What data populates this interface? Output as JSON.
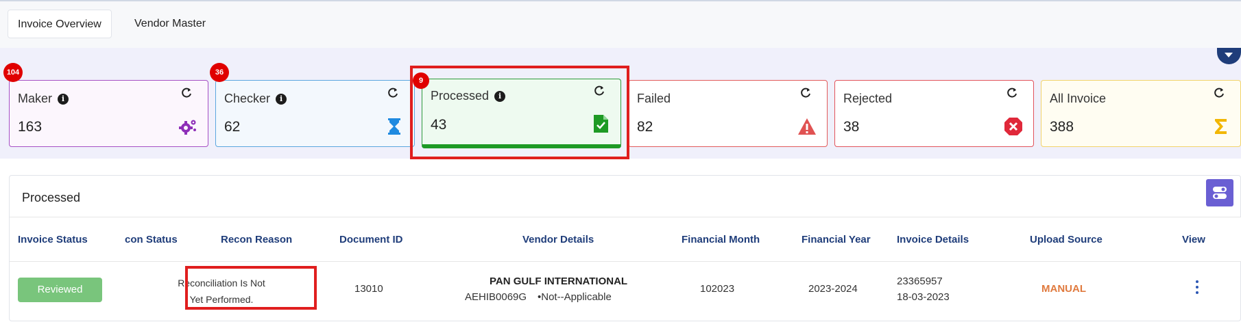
{
  "tabs": [
    {
      "label": "Invoice Overview",
      "active": true
    },
    {
      "label": "Vendor Master",
      "active": false
    }
  ],
  "cards": {
    "maker": {
      "label": "Maker",
      "count": "163",
      "badge": "104",
      "icon": "gears-icon",
      "color": "#8e2fb8"
    },
    "checker": {
      "label": "Checker",
      "count": "62",
      "badge": "36",
      "icon": "hourglass-icon",
      "color": "#1f8ae0"
    },
    "processed": {
      "label": "Processed",
      "count": "43",
      "badge": "9",
      "icon": "file-check-icon",
      "color": "#1e9a25"
    },
    "failed": {
      "label": "Failed",
      "count": "82",
      "icon": "warning-icon",
      "color": "#e05252"
    },
    "rejected": {
      "label": "Rejected",
      "count": "38",
      "icon": "x-circle-icon",
      "color": "#e0283a"
    },
    "all": {
      "label": "All Invoice",
      "count": "388",
      "icon": "sigma-icon",
      "color": "#f2b705"
    }
  },
  "panel": {
    "title": "Processed",
    "columns": [
      "Invoice Status",
      "con Status",
      "Recon Reason",
      "Document ID",
      "Vendor Details",
      "Financial Month",
      "Financial Year",
      "Invoice Details",
      "Upload Source",
      "View"
    ],
    "row": {
      "invoice_status": "Reviewed",
      "recon_reason_line1": "Reconciliation Is Not",
      "recon_reason_line2": "Yet Performed.",
      "document_id": "13010",
      "vendor_name": "PAN GULF INTERNATIONAL",
      "vendor_code": "AEHIB0069G",
      "vendor_extra": "•Not--Applicable",
      "financial_month": "102023",
      "financial_year": "2023-2024",
      "invoice_number": "23365957",
      "invoice_date": "18-03-2023",
      "upload_source": "MANUAL"
    }
  },
  "colors": {
    "accent": "#1f3d7a",
    "upload_source": "#e07a3e",
    "highlight": "#e01e1e",
    "reviewed": "#79c57c"
  }
}
